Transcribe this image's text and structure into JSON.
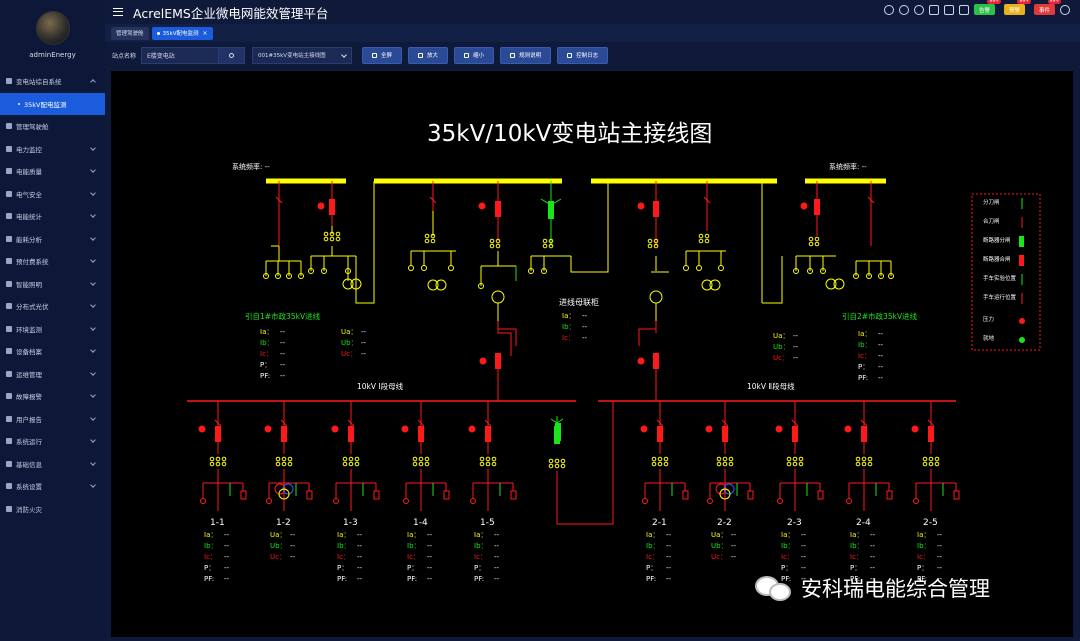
{
  "app": {
    "title": "AcrelEMS企业微电网能效管理平台",
    "user": "adminEnergy"
  },
  "header": {
    "badges": [
      {
        "label": "告警",
        "count": "99+",
        "color": "#2fbf4a"
      },
      {
        "label": "预警",
        "count": "99+",
        "color": "#e8b21a"
      },
      {
        "label": "事件",
        "count": "99+",
        "color": "#e23a3a"
      }
    ]
  },
  "sidebar": {
    "items": [
      {
        "label": "变电站综自系统",
        "open": true
      },
      {
        "label": "35kV配电监测",
        "sub": true
      },
      {
        "label": "管理驾驶舱"
      },
      {
        "label": "电力监控"
      },
      {
        "label": "电能质量"
      },
      {
        "label": "电气安全"
      },
      {
        "label": "电能统计"
      },
      {
        "label": "能耗分析"
      },
      {
        "label": "预付费系统"
      },
      {
        "label": "智能照明"
      },
      {
        "label": "分布式光伏"
      },
      {
        "label": "环境监测"
      },
      {
        "label": "设备档案"
      },
      {
        "label": "运维管理"
      },
      {
        "label": "故障报警"
      },
      {
        "label": "用户报告"
      },
      {
        "label": "系统运行"
      },
      {
        "label": "基础信息"
      },
      {
        "label": "系统设置"
      },
      {
        "label": "消防火灾"
      }
    ]
  },
  "tabs": [
    {
      "label": "管理驾驶舱",
      "active": false
    },
    {
      "label": "35kV配电监测",
      "active": true
    }
  ],
  "toolbar": {
    "station_label": "站点名称",
    "station_value": "E楼变电站",
    "diagram_select": "001#35kV变电站主接线图",
    "buttons": [
      "全屏",
      "放大",
      "缩小",
      "规则说明",
      "控制日志"
    ]
  },
  "diagram": {
    "title": "35kV/10kV变电站主接线图",
    "freq_label_left": "系统频率: --",
    "freq_label_right": "系统频率: --",
    "incoming_left": "引自1#市政35kV进线",
    "incoming_right": "引自2#市政35kV进线",
    "bus_tie_title": "进线母联柜",
    "bus_left": "10kV Ⅰ段母线",
    "bus_right": "10kV Ⅱ段母线",
    "feeders": [
      "1-1",
      "1-2",
      "1-3",
      "1-4",
      "1-5",
      "2-1",
      "2-2",
      "2-3",
      "2-4",
      "2-5"
    ],
    "legend": [
      "分刀闸",
      "合刀闸",
      "断路器分闸",
      "断路器合闸",
      "手车实验位置",
      "手车运行位置",
      "压力",
      "就地"
    ]
  },
  "watermark": "安科瑞电能综合管理"
}
